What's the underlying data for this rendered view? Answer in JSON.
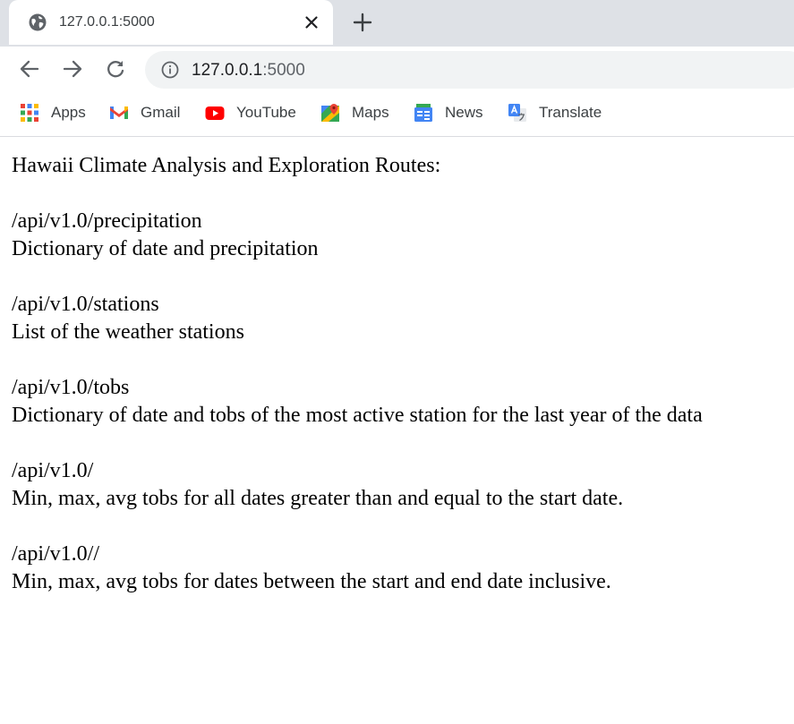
{
  "browser": {
    "tab_title": "127.0.0.1:5000",
    "url_host": "127.0.0.1",
    "url_port": ":5000",
    "bookmarks": [
      {
        "label": "Apps",
        "icon": "apps-grid-icon"
      },
      {
        "label": "Gmail",
        "icon": "gmail-icon"
      },
      {
        "label": "YouTube",
        "icon": "youtube-icon"
      },
      {
        "label": "Maps",
        "icon": "maps-icon"
      },
      {
        "label": "News",
        "icon": "news-icon"
      },
      {
        "label": "Translate",
        "icon": "translate-icon"
      }
    ]
  },
  "page": {
    "heading": "Hawaii Climate Analysis and Exploration Routes:",
    "routes": [
      {
        "path": "/api/v1.0/precipitation",
        "description": "Dictionary of date and precipitation"
      },
      {
        "path": "/api/v1.0/stations",
        "description": "List of the weather stations"
      },
      {
        "path": "/api/v1.0/tobs",
        "description": "Dictionary of date and tobs of the most active station for the last year of the data"
      },
      {
        "path": "/api/v1.0/",
        "description": "Min, max, avg tobs for all dates greater than and equal to the start date."
      },
      {
        "path": "/api/v1.0//",
        "description": "Min, max, avg tobs for dates between the start and end date inclusive."
      }
    ]
  }
}
